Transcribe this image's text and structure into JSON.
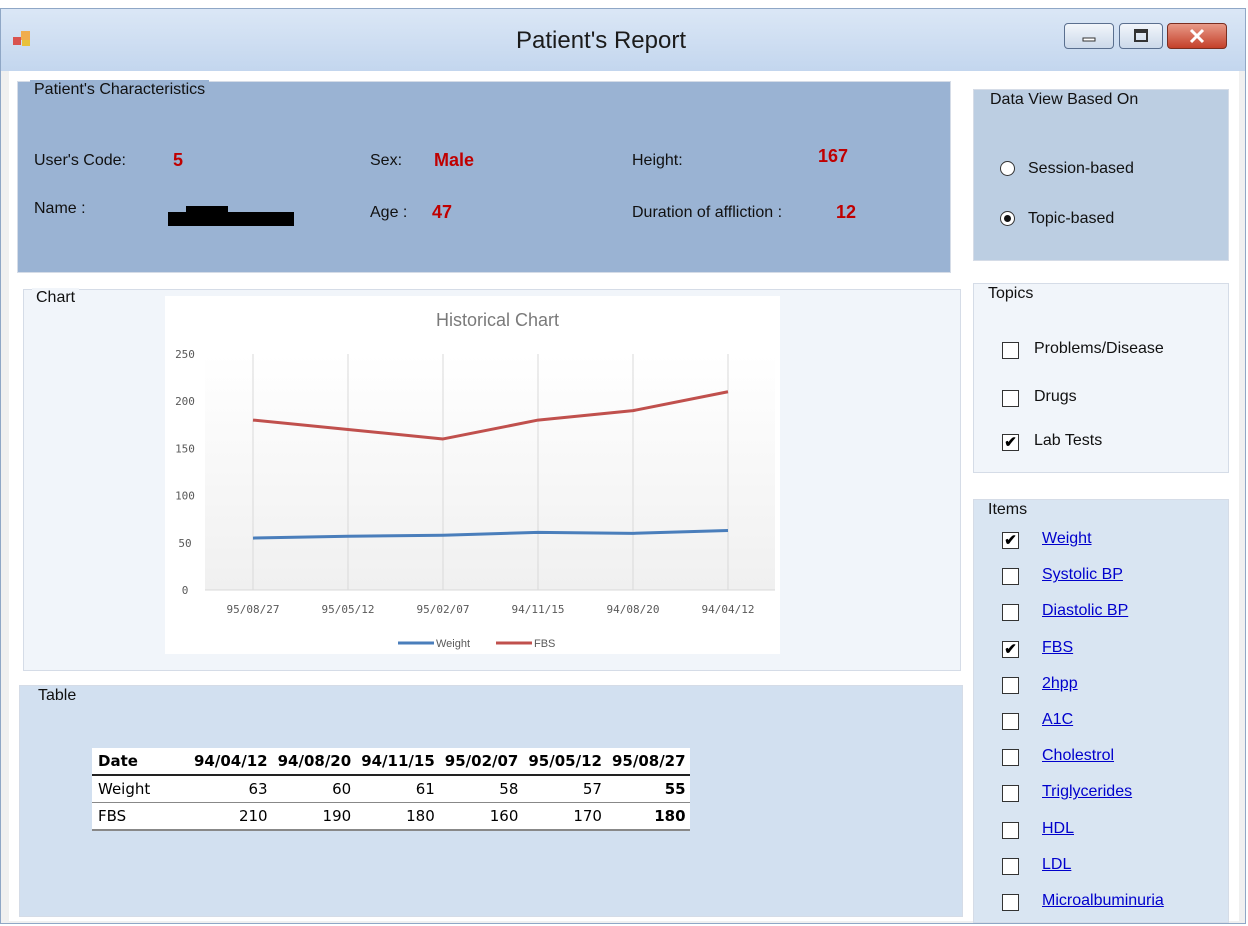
{
  "window": {
    "title": "Patient's Report"
  },
  "characteristics": {
    "group_label": "Patient's Characteristics",
    "user_code_label": "User's Code:",
    "user_code_value": "5",
    "name_label": "Name :",
    "sex_label": "Sex:",
    "sex_value": "Male",
    "age_label": "Age :",
    "age_value": "47",
    "height_label": "Height:",
    "height_value": "167",
    "duration_label": "Duration of affliction :",
    "duration_value": "12"
  },
  "data_view": {
    "group_label": "Data View Based On",
    "options": [
      {
        "label": "Session-based",
        "selected": false
      },
      {
        "label": "Topic-based",
        "selected": true
      }
    ]
  },
  "topics": {
    "group_label": "Topics",
    "options": [
      {
        "label": "Problems/Disease",
        "checked": false
      },
      {
        "label": "Drugs",
        "checked": false
      },
      {
        "label": "Lab Tests",
        "checked": true
      }
    ]
  },
  "items": {
    "group_label": "Items",
    "options": [
      {
        "label": "Weight",
        "checked": true
      },
      {
        "label": "Systolic BP",
        "checked": false
      },
      {
        "label": "Diastolic BP",
        "checked": false
      },
      {
        "label": "FBS",
        "checked": true
      },
      {
        "label": "2hpp",
        "checked": false
      },
      {
        "label": "A1C",
        "checked": false
      },
      {
        "label": "Cholestrol",
        "checked": false
      },
      {
        "label": "Triglycerides",
        "checked": false
      },
      {
        "label": "HDL",
        "checked": false
      },
      {
        "label": "LDL",
        "checked": false
      },
      {
        "label": "Microalbuminuria",
        "checked": false
      }
    ]
  },
  "chart_section": {
    "group_label": "Chart"
  },
  "chart_data": {
    "type": "line",
    "title": "Historical Chart",
    "categories": [
      "95/08/27",
      "95/05/12",
      "95/02/07",
      "94/11/15",
      "94/08/20",
      "94/04/12"
    ],
    "series": [
      {
        "name": "Weight",
        "values": [
          55,
          57,
          58,
          61,
          60,
          63
        ],
        "color": "#4a7ebb"
      },
      {
        "name": "FBS",
        "values": [
          180,
          170,
          160,
          180,
          190,
          210
        ],
        "color": "#c0504d"
      }
    ],
    "ylim": [
      0,
      250
    ],
    "yticks": [
      "0",
      "50",
      "100",
      "150",
      "200",
      "250"
    ],
    "grid": true,
    "legend": "bottom"
  },
  "table_section": {
    "group_label": "Table",
    "header": [
      "Date",
      "94/04/12",
      "94/08/20",
      "94/11/15",
      "95/02/07",
      "95/05/12",
      "95/08/27"
    ],
    "rows": [
      [
        "Weight",
        "63",
        "60",
        "61",
        "58",
        "57",
        "55"
      ],
      [
        "FBS",
        "210",
        "190",
        "180",
        "160",
        "170",
        "180"
      ]
    ]
  },
  "colors": {
    "value_red": "#c00000",
    "characteristics_bg": "#9ab3d3",
    "link_blue": "#0000cc"
  }
}
